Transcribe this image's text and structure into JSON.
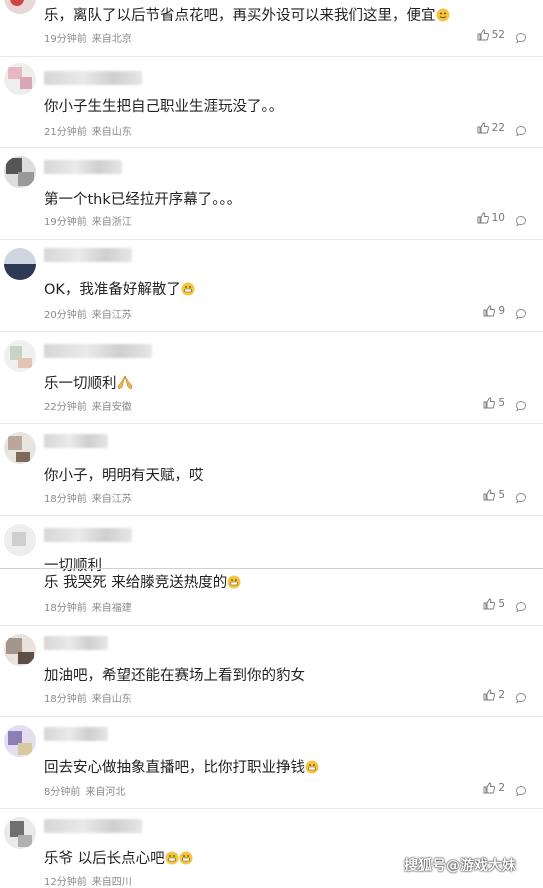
{
  "comments": [
    {
      "text": "乐，离队了以后节省点花吧，再买外设可以来我们这里，便宜",
      "time": "19分钟前",
      "location": "来自北京",
      "likes": "52",
      "emoji": true
    },
    {
      "text": "你小子生生把自己职业生涯玩没了。。",
      "time": "21分钟前",
      "location": "来自山东",
      "likes": "22",
      "emoji": false
    },
    {
      "text": "第一个thk已经拉开序幕了。。。",
      "time": "19分钟前",
      "location": "来自浙江",
      "likes": "10",
      "emoji": false
    },
    {
      "text": "OK，我准备好解散了",
      "time": "20分钟前",
      "location": "来自江苏",
      "likes": "9",
      "emoji": true
    },
    {
      "text": "乐一切顺利",
      "time": "22分钟前",
      "location": "来自安徽",
      "likes": "5",
      "emoji": true
    },
    {
      "text": "你小子，明明有天赋，哎",
      "time": "18分钟前",
      "location": "来自江苏",
      "likes": "5",
      "emoji": false
    },
    {
      "text": "一切顺利",
      "time": "",
      "location": "",
      "likes": "",
      "emoji": false
    },
    {
      "text": "乐 我哭死 来给滕竞送热度的",
      "time": "18分钟前",
      "location": "来自福建",
      "likes": "5",
      "emoji": true
    },
    {
      "text": "加油吧，希望还能在赛场上看到你的豹女",
      "time": "18分钟前",
      "location": "来自山东",
      "likes": "2",
      "emoji": false
    },
    {
      "text": "回去安心做抽象直播吧，比你打职业挣钱",
      "time": "8分钟前",
      "location": "来自河北",
      "likes": "2",
      "emoji": true
    },
    {
      "text": "乐爷 以后长点心吧",
      "time": "12分钟前",
      "location": "来自四川",
      "likes": "",
      "emoji": true
    }
  ],
  "watermark": "搜狐号@游戏大妹",
  "colors": {
    "text": "#222222",
    "meta": "#8a8a8a",
    "divider": "#e8e8e8"
  }
}
